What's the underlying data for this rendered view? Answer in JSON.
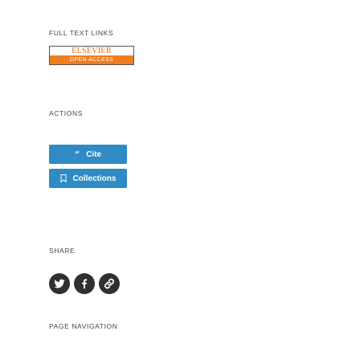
{
  "full_text_links": {
    "label": "FULL TEXT LINKS",
    "badge": {
      "publisher": "ELSEVIER",
      "access": "OPEN ACCESS",
      "publisher_color": "#e46a16",
      "access_bg": "#f07d1e"
    }
  },
  "actions": {
    "label": "ACTIONS",
    "buttons": [
      {
        "label": "Cite",
        "icon": "quote-icon"
      },
      {
        "label": "Collections",
        "icon": "bookmark-icon"
      }
    ],
    "button_color": "#2f8bc4"
  },
  "share": {
    "label": "SHARE",
    "icons": [
      "twitter-icon",
      "facebook-icon",
      "permalink-icon"
    ],
    "circle_color": "#303030"
  },
  "page_navigation": {
    "label": "PAGE NAVIGATION"
  }
}
